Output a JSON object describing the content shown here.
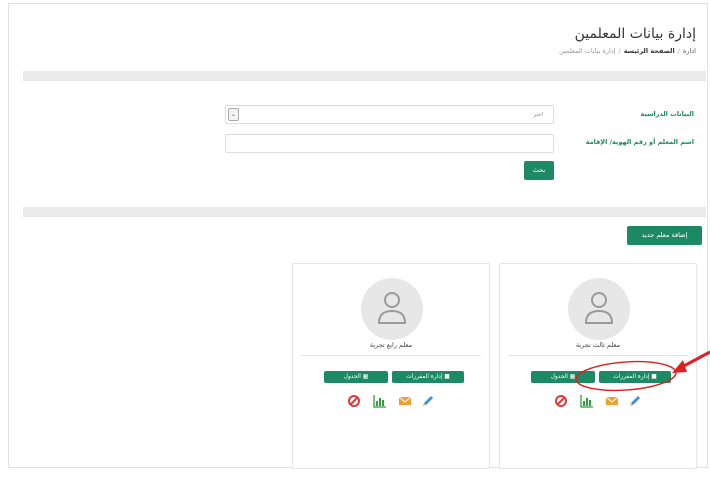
{
  "page": {
    "title": "إدارة بيانات المعلمين"
  },
  "breadcrumb": {
    "root": "ادارة",
    "home": "الصفحة الرئيسة",
    "current": "إدارة بيانات المعلمين",
    "separator": "/"
  },
  "search": {
    "study_data_label": "البيانات الدراسية",
    "select_value": "اختر",
    "teacher_id_label": "اسم المعلم أو رقم الهوية/ الإقامة",
    "teacher_id_value": "",
    "search_button": "بحث"
  },
  "toolbar": {
    "add_teacher_button": "إضافة معلم جديد"
  },
  "teachers": [
    {
      "name": "معلم ثالث تجربة",
      "manage_courses_label": "إدارة المقررات",
      "schedule_label": "الجدول",
      "highlighted": true
    },
    {
      "name": "معلم رابع تجربة",
      "manage_courses_label": "إدارة المقررات",
      "schedule_label": "الجدول",
      "highlighted": false
    }
  ],
  "icons": {
    "book": "book-icon",
    "calendar": "calendar-icon",
    "edit": "pencil-icon",
    "message": "envelope-icon",
    "stats": "bar-chart-icon",
    "disable": "ban-icon"
  },
  "colors": {
    "primary": "#1d8a66",
    "label_green": "#1b8a68",
    "edit_blue": "#3a8ee6",
    "mail_orange": "#f0a030",
    "stats_green": "#2e9e3e",
    "ban_red": "#e23a3a",
    "annotation_red": "#e02020"
  }
}
